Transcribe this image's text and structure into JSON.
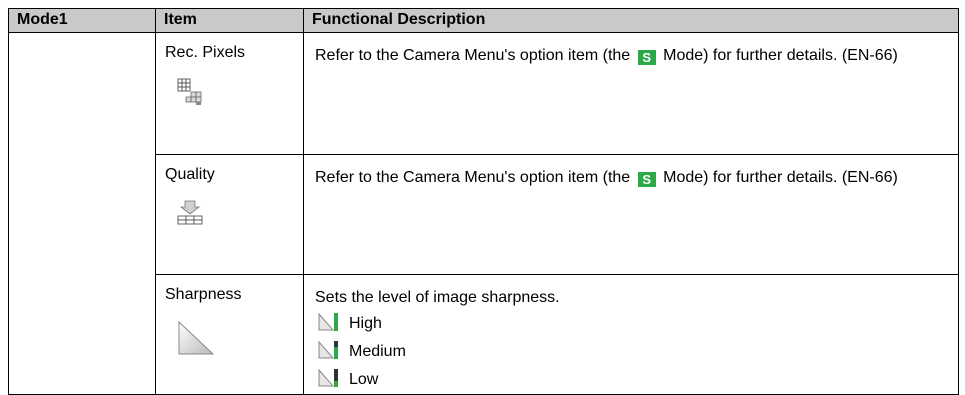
{
  "header": {
    "col1": "Mode1",
    "col2": "Item",
    "col3": "Functional Description"
  },
  "rows": [
    {
      "item": "Rec. Pixels",
      "icon": "rec-pixels-icon",
      "desc_before": "Refer to the Camera Menu's option item (the",
      "badge": "S",
      "desc_after": "Mode) for further details. (EN-66)"
    },
    {
      "item": "Quality",
      "icon": "quality-icon",
      "desc_before": "Refer to the Camera Menu's option item (the",
      "badge": "S",
      "desc_after": "Mode) for further details. (EN-66)"
    },
    {
      "item": "Sharpness",
      "icon": "sharpness-icon",
      "desc": "Sets the level of image sharpness.",
      "levels": [
        "High",
        "Medium",
        "Low"
      ]
    }
  ],
  "colors": {
    "header_bg": "#c9c9c9",
    "badge_bg": "#2ea94a",
    "sharp_accent": "#2ea94a"
  }
}
